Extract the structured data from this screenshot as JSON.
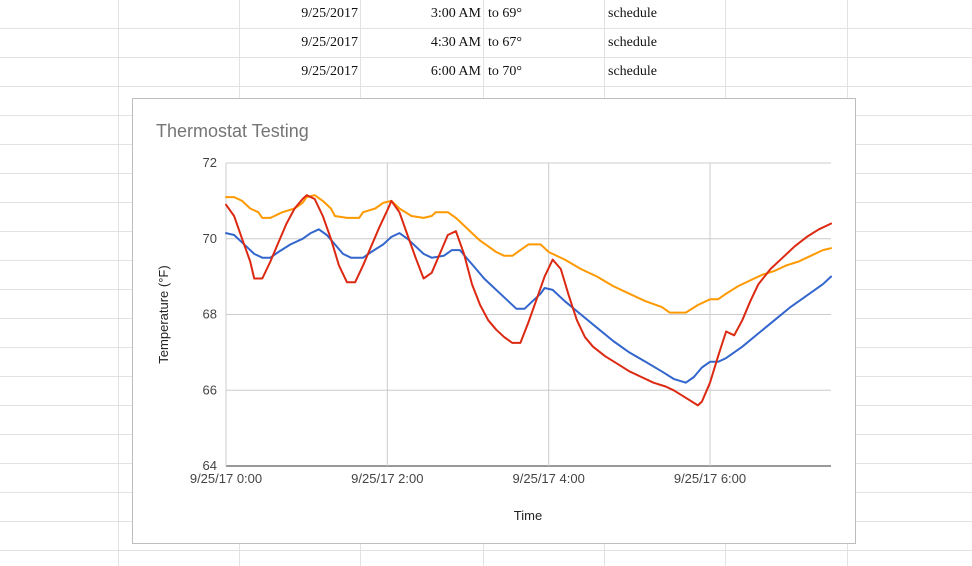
{
  "spreadsheet": {
    "rows": [
      {
        "date": "9/25/2017",
        "time": "3:00 AM",
        "target": "to 69°",
        "type": "schedule"
      },
      {
        "date": "9/25/2017",
        "time": "4:30 AM",
        "target": "to 67°",
        "type": "schedule"
      },
      {
        "date": "9/25/2017",
        "time": "6:00 AM",
        "target": "to 70°",
        "type": "schedule"
      }
    ]
  },
  "chart_data": {
    "type": "line",
    "title": "Thermostat Testing",
    "xlabel": "Time",
    "ylabel": "Temperature (°F)",
    "x_ticks": [
      "9/25/17 0:00",
      "9/25/17 2:00",
      "9/25/17 4:00",
      "9/25/17 6:00"
    ],
    "y_ticks": [
      "64",
      "66",
      "68",
      "70",
      "72"
    ],
    "ylim": [
      64,
      72
    ],
    "xlim_hours": [
      0,
      7.5
    ],
    "grid": true,
    "legend": "none",
    "series": [
      {
        "color": "#ff9900",
        "points": [
          [
            0,
            71.1
          ],
          [
            0.1,
            71.1
          ],
          [
            0.2,
            71.0
          ],
          [
            0.3,
            70.8
          ],
          [
            0.4,
            70.7
          ],
          [
            0.45,
            70.55
          ],
          [
            0.55,
            70.55
          ],
          [
            0.7,
            70.7
          ],
          [
            0.85,
            70.8
          ],
          [
            0.95,
            70.95
          ],
          [
            1.0,
            71.1
          ],
          [
            1.1,
            71.15
          ],
          [
            1.2,
            71.0
          ],
          [
            1.3,
            70.8
          ],
          [
            1.35,
            70.6
          ],
          [
            1.5,
            70.55
          ],
          [
            1.65,
            70.55
          ],
          [
            1.7,
            70.7
          ],
          [
            1.85,
            70.8
          ],
          [
            1.95,
            70.95
          ],
          [
            2.05,
            71.0
          ],
          [
            2.15,
            70.8
          ],
          [
            2.3,
            70.6
          ],
          [
            2.45,
            70.55
          ],
          [
            2.55,
            70.6
          ],
          [
            2.6,
            70.7
          ],
          [
            2.75,
            70.7
          ],
          [
            2.85,
            70.55
          ],
          [
            2.95,
            70.35
          ],
          [
            3.05,
            70.15
          ],
          [
            3.15,
            69.95
          ],
          [
            3.25,
            69.8
          ],
          [
            3.35,
            69.65
          ],
          [
            3.45,
            69.55
          ],
          [
            3.55,
            69.55
          ],
          [
            3.65,
            69.7
          ],
          [
            3.75,
            69.85
          ],
          [
            3.9,
            69.85
          ],
          [
            4.0,
            69.65
          ],
          [
            4.2,
            69.45
          ],
          [
            4.4,
            69.2
          ],
          [
            4.6,
            69.0
          ],
          [
            4.8,
            68.75
          ],
          [
            5.0,
            68.55
          ],
          [
            5.2,
            68.35
          ],
          [
            5.4,
            68.2
          ],
          [
            5.5,
            68.05
          ],
          [
            5.7,
            68.05
          ],
          [
            5.85,
            68.25
          ],
          [
            6.0,
            68.4
          ],
          [
            6.1,
            68.4
          ],
          [
            6.2,
            68.55
          ],
          [
            6.35,
            68.75
          ],
          [
            6.5,
            68.9
          ],
          [
            6.65,
            69.05
          ],
          [
            6.8,
            69.15
          ],
          [
            6.95,
            69.3
          ],
          [
            7.1,
            69.4
          ],
          [
            7.25,
            69.55
          ],
          [
            7.4,
            69.7
          ],
          [
            7.5,
            69.75
          ]
        ]
      },
      {
        "color": "#3366cc",
        "points": [
          [
            0,
            70.15
          ],
          [
            0.1,
            70.1
          ],
          [
            0.25,
            69.8
          ],
          [
            0.35,
            69.6
          ],
          [
            0.45,
            69.5
          ],
          [
            0.55,
            69.5
          ],
          [
            0.65,
            69.65
          ],
          [
            0.8,
            69.85
          ],
          [
            0.95,
            70.0
          ],
          [
            1.05,
            70.15
          ],
          [
            1.15,
            70.25
          ],
          [
            1.25,
            70.1
          ],
          [
            1.35,
            69.85
          ],
          [
            1.45,
            69.6
          ],
          [
            1.55,
            69.5
          ],
          [
            1.7,
            69.5
          ],
          [
            1.8,
            69.65
          ],
          [
            1.95,
            69.85
          ],
          [
            2.05,
            70.05
          ],
          [
            2.15,
            70.15
          ],
          [
            2.25,
            70.0
          ],
          [
            2.35,
            69.8
          ],
          [
            2.45,
            69.6
          ],
          [
            2.55,
            69.5
          ],
          [
            2.7,
            69.55
          ],
          [
            2.8,
            69.7
          ],
          [
            2.9,
            69.7
          ],
          [
            3.0,
            69.45
          ],
          [
            3.1,
            69.2
          ],
          [
            3.2,
            68.95
          ],
          [
            3.3,
            68.75
          ],
          [
            3.4,
            68.55
          ],
          [
            3.5,
            68.35
          ],
          [
            3.6,
            68.15
          ],
          [
            3.7,
            68.15
          ],
          [
            3.8,
            68.35
          ],
          [
            3.9,
            68.55
          ],
          [
            3.95,
            68.7
          ],
          [
            4.05,
            68.65
          ],
          [
            4.2,
            68.35
          ],
          [
            4.4,
            68.0
          ],
          [
            4.6,
            67.65
          ],
          [
            4.8,
            67.3
          ],
          [
            5.0,
            67.0
          ],
          [
            5.2,
            66.75
          ],
          [
            5.4,
            66.5
          ],
          [
            5.55,
            66.3
          ],
          [
            5.7,
            66.2
          ],
          [
            5.8,
            66.35
          ],
          [
            5.9,
            66.6
          ],
          [
            6.0,
            66.75
          ],
          [
            6.1,
            66.75
          ],
          [
            6.2,
            66.85
          ],
          [
            6.4,
            67.15
          ],
          [
            6.6,
            67.5
          ],
          [
            6.8,
            67.85
          ],
          [
            7.0,
            68.2
          ],
          [
            7.2,
            68.5
          ],
          [
            7.4,
            68.8
          ],
          [
            7.5,
            69.0
          ]
        ]
      },
      {
        "color": "#dc2912",
        "points": [
          [
            0,
            70.9
          ],
          [
            0.1,
            70.6
          ],
          [
            0.2,
            70.0
          ],
          [
            0.3,
            69.4
          ],
          [
            0.35,
            68.95
          ],
          [
            0.45,
            68.95
          ],
          [
            0.55,
            69.4
          ],
          [
            0.65,
            69.9
          ],
          [
            0.75,
            70.4
          ],
          [
            0.85,
            70.8
          ],
          [
            0.95,
            71.05
          ],
          [
            1.0,
            71.15
          ],
          [
            1.1,
            71.05
          ],
          [
            1.2,
            70.6
          ],
          [
            1.3,
            70.0
          ],
          [
            1.4,
            69.3
          ],
          [
            1.5,
            68.85
          ],
          [
            1.6,
            68.85
          ],
          [
            1.7,
            69.3
          ],
          [
            1.8,
            69.8
          ],
          [
            1.9,
            70.3
          ],
          [
            2.0,
            70.75
          ],
          [
            2.05,
            71.0
          ],
          [
            2.15,
            70.7
          ],
          [
            2.25,
            70.1
          ],
          [
            2.35,
            69.5
          ],
          [
            2.45,
            68.95
          ],
          [
            2.55,
            69.1
          ],
          [
            2.65,
            69.6
          ],
          [
            2.75,
            70.1
          ],
          [
            2.85,
            70.2
          ],
          [
            2.95,
            69.6
          ],
          [
            3.05,
            68.8
          ],
          [
            3.15,
            68.25
          ],
          [
            3.25,
            67.85
          ],
          [
            3.35,
            67.6
          ],
          [
            3.45,
            67.4
          ],
          [
            3.55,
            67.25
          ],
          [
            3.65,
            67.25
          ],
          [
            3.75,
            67.8
          ],
          [
            3.85,
            68.4
          ],
          [
            3.95,
            69.0
          ],
          [
            4.05,
            69.45
          ],
          [
            4.15,
            69.2
          ],
          [
            4.25,
            68.5
          ],
          [
            4.35,
            67.85
          ],
          [
            4.45,
            67.4
          ],
          [
            4.55,
            67.15
          ],
          [
            4.7,
            66.9
          ],
          [
            4.85,
            66.7
          ],
          [
            5.0,
            66.5
          ],
          [
            5.15,
            66.35
          ],
          [
            5.3,
            66.2
          ],
          [
            5.45,
            66.1
          ],
          [
            5.55,
            66.0
          ],
          [
            5.7,
            65.8
          ],
          [
            5.85,
            65.6
          ],
          [
            5.9,
            65.7
          ],
          [
            6.0,
            66.2
          ],
          [
            6.1,
            66.9
          ],
          [
            6.2,
            67.55
          ],
          [
            6.3,
            67.45
          ],
          [
            6.4,
            67.85
          ],
          [
            6.5,
            68.35
          ],
          [
            6.6,
            68.8
          ],
          [
            6.75,
            69.2
          ],
          [
            6.9,
            69.5
          ],
          [
            7.05,
            69.8
          ],
          [
            7.2,
            70.05
          ],
          [
            7.35,
            70.25
          ],
          [
            7.5,
            70.4
          ]
        ]
      }
    ]
  }
}
